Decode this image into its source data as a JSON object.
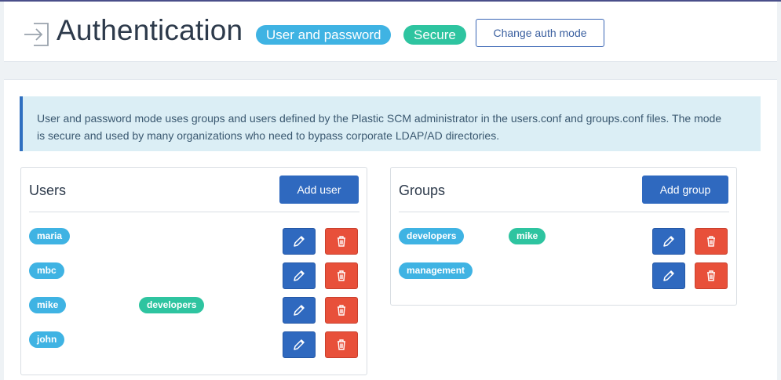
{
  "header": {
    "title": "Authentication",
    "mode_badge": "User and password",
    "secure_badge": "Secure",
    "change_button": "Change auth mode"
  },
  "info": {
    "line1": "User and password mode uses groups and users defined by the Plastic SCM administrator in the users.conf and groups.conf files. The mode",
    "line2": "is secure and used by many organizations who need to bypass corporate LDAP/AD directories."
  },
  "users": {
    "title": "Users",
    "add_button": "Add user",
    "rows": [
      {
        "name": "maria",
        "group": ""
      },
      {
        "name": "mbc",
        "group": ""
      },
      {
        "name": "mike",
        "group": "developers"
      },
      {
        "name": "john",
        "group": ""
      }
    ]
  },
  "groups": {
    "title": "Groups",
    "add_button": "Add group",
    "rows": [
      {
        "name": "developers",
        "member": "mike"
      },
      {
        "name": "management",
        "member": ""
      }
    ]
  },
  "icons": {
    "header": "login-arrow-icon",
    "edit": "pencil-icon",
    "delete": "trash-icon"
  },
  "colors": {
    "primary": "#2f69bf",
    "danger": "#e8503a",
    "info_tag": "#3fb3e3",
    "success_tag": "#2ec4a0"
  }
}
